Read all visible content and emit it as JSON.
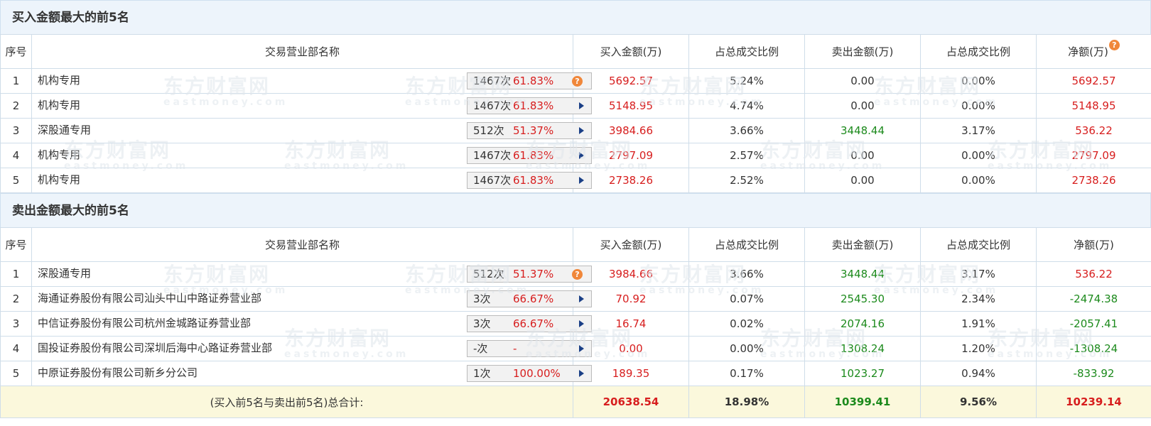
{
  "buy_section": {
    "title": "买入金额最大的前5名",
    "headers": [
      "序号",
      "交易营业部名称",
      "买入金额(万)",
      "占总成交比例",
      "卖出金额(万)",
      "占总成交比例",
      "净额(万)"
    ],
    "rows": [
      {
        "no": "1",
        "name": "机构专用",
        "count": "1467次",
        "pct": "61.83%",
        "buy": "5692.57",
        "buy_ratio": "5.24%",
        "sell": "0.00",
        "sell_ratio": "0.00%",
        "net": "5692.57"
      },
      {
        "no": "2",
        "name": "机构专用",
        "count": "1467次",
        "pct": "61.83%",
        "buy": "5148.95",
        "buy_ratio": "4.74%",
        "sell": "0.00",
        "sell_ratio": "0.00%",
        "net": "5148.95"
      },
      {
        "no": "3",
        "name": "深股通专用",
        "count": "512次",
        "pct": "51.37%",
        "buy": "3984.66",
        "buy_ratio": "3.66%",
        "sell": "3448.44",
        "sell_ratio": "3.17%",
        "net": "536.22"
      },
      {
        "no": "4",
        "name": "机构专用",
        "count": "1467次",
        "pct": "61.83%",
        "buy": "2797.09",
        "buy_ratio": "2.57%",
        "sell": "0.00",
        "sell_ratio": "0.00%",
        "net": "2797.09"
      },
      {
        "no": "5",
        "name": "机构专用",
        "count": "1467次",
        "pct": "61.83%",
        "buy": "2738.26",
        "buy_ratio": "2.52%",
        "sell": "0.00",
        "sell_ratio": "0.00%",
        "net": "2738.26"
      }
    ]
  },
  "sell_section": {
    "title": "卖出金额最大的前5名",
    "headers": [
      "序号",
      "交易营业部名称",
      "买入金额(万)",
      "占总成交比例",
      "卖出金额(万)",
      "占总成交比例",
      "净额(万)"
    ],
    "rows": [
      {
        "no": "1",
        "name": "深股通专用",
        "count": "512次",
        "pct": "51.37%",
        "buy": "3984.66",
        "buy_ratio": "3.66%",
        "sell": "3448.44",
        "sell_ratio": "3.17%",
        "net": "536.22"
      },
      {
        "no": "2",
        "name": "海通证券股份有限公司汕头中山中路证券营业部",
        "count": "3次",
        "pct": "66.67%",
        "buy": "70.92",
        "buy_ratio": "0.07%",
        "sell": "2545.30",
        "sell_ratio": "2.34%",
        "net": "-2474.38"
      },
      {
        "no": "3",
        "name": "中信证券股份有限公司杭州金城路证券营业部",
        "count": "3次",
        "pct": "66.67%",
        "buy": "16.74",
        "buy_ratio": "0.02%",
        "sell": "2074.16",
        "sell_ratio": "1.91%",
        "net": "-2057.41"
      },
      {
        "no": "4",
        "name": "国投证券股份有限公司深圳后海中心路证券营业部",
        "count": "-次",
        "pct": "-",
        "buy": "0.00",
        "buy_ratio": "0.00%",
        "sell": "1308.24",
        "sell_ratio": "1.20%",
        "net": "-1308.24"
      },
      {
        "no": "5",
        "name": "中原证券股份有限公司新乡分公司",
        "count": "1次",
        "pct": "100.00%",
        "buy": "189.35",
        "buy_ratio": "0.17%",
        "sell": "1023.27",
        "sell_ratio": "0.94%",
        "net": "-833.92"
      }
    ],
    "total": {
      "label": "(买入前5名与卖出前5名)总合计:",
      "buy": "20638.54",
      "buy_ratio": "18.98%",
      "sell": "10399.41",
      "sell_ratio": "9.56%",
      "net": "10239.14"
    }
  },
  "help_icon_glyph": "?",
  "watermark": {
    "cn": "东方财富网",
    "en": "eastmoney.com"
  },
  "colors": {
    "up": "#d71e1e",
    "down": "#1c8a1c",
    "header_bg": "#edf4fb",
    "total_bg": "#fbf8dc",
    "help": "#f0873a"
  }
}
